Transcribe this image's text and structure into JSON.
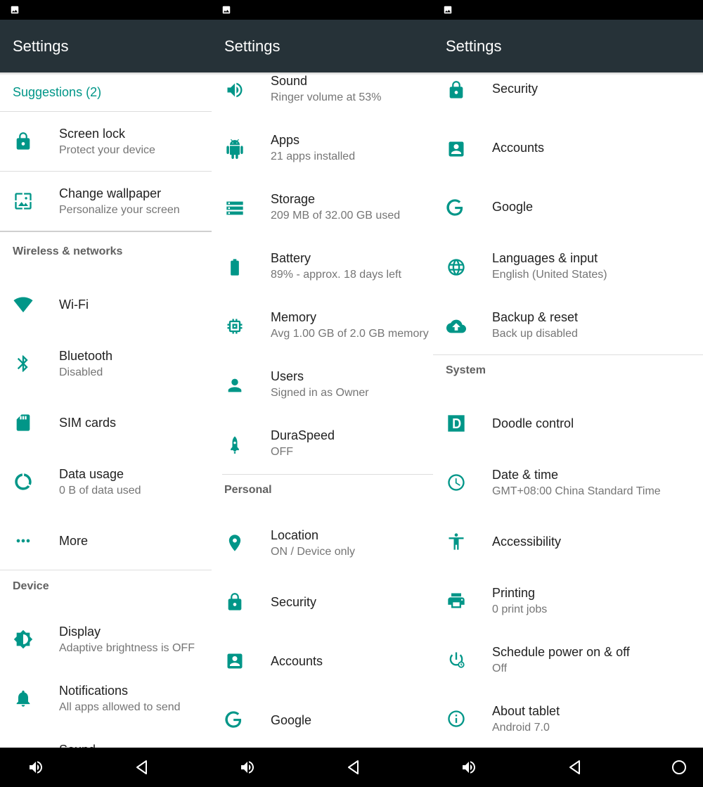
{
  "colors": {
    "accent": "#009688",
    "appbar": "#263238",
    "statusbar": "#000000"
  },
  "panels": [
    {
      "title": "Settings",
      "suggestions": "Suggestions (2)",
      "items": [
        {
          "title": "Screen lock",
          "subtitle": "Protect your device",
          "icon": "lock-icon"
        },
        {
          "title": "Change wallpaper",
          "subtitle": "Personalize your screen",
          "icon": "wallpaper-icon"
        },
        {
          "header": "Wireless & networks"
        },
        {
          "title": "Wi-Fi",
          "icon": "wifi-icon"
        },
        {
          "title": "Bluetooth",
          "subtitle": "Disabled",
          "icon": "bluetooth-icon"
        },
        {
          "title": "SIM cards",
          "icon": "sim-card-icon"
        },
        {
          "title": "Data usage",
          "subtitle": "0 B of data used",
          "icon": "data-usage-icon"
        },
        {
          "title": "More",
          "icon": "more-icon"
        },
        {
          "header": "Device"
        },
        {
          "title": "Display",
          "subtitle": "Adaptive brightness is OFF",
          "icon": "brightness-icon"
        },
        {
          "title": "Notifications",
          "subtitle": "All apps allowed to send",
          "icon": "bell-icon"
        },
        {
          "title": "Sound",
          "icon": "speaker-icon"
        }
      ]
    },
    {
      "title": "Settings",
      "items": [
        {
          "title": "Sound",
          "subtitle": "Ringer volume at 53%",
          "icon": "speaker-icon"
        },
        {
          "title": "Apps",
          "subtitle": "21 apps installed",
          "icon": "android-icon"
        },
        {
          "title": "Storage",
          "subtitle": "209 MB of 32.00 GB used",
          "icon": "storage-icon"
        },
        {
          "title": "Battery",
          "subtitle": "89% - approx. 18 days left",
          "icon": "battery-icon"
        },
        {
          "title": "Memory",
          "subtitle": "Avg 1.00 GB of 2.0 GB memory",
          "icon": "memory-icon"
        },
        {
          "title": "Users",
          "subtitle": "Signed in as Owner",
          "icon": "person-icon"
        },
        {
          "title": "DuraSpeed",
          "subtitle": "OFF",
          "icon": "rocket-icon"
        },
        {
          "header": "Personal"
        },
        {
          "title": "Location",
          "subtitle": "ON / Device only",
          "icon": "location-icon"
        },
        {
          "title": "Security",
          "icon": "lock-icon"
        },
        {
          "title": "Accounts",
          "icon": "account-box-icon"
        },
        {
          "title": "Google",
          "icon": "google-icon"
        }
      ]
    },
    {
      "title": "Settings",
      "items": [
        {
          "title": "Security",
          "icon": "lock-icon"
        },
        {
          "title": "Accounts",
          "icon": "account-box-icon"
        },
        {
          "title": "Google",
          "icon": "google-icon"
        },
        {
          "title": "Languages & input",
          "subtitle": "English (United States)",
          "icon": "globe-icon"
        },
        {
          "title": "Backup & reset",
          "subtitle": "Back up disabled",
          "icon": "cloud-upload-icon"
        },
        {
          "header": "System"
        },
        {
          "title": "Doodle control",
          "icon": "doodle-icon"
        },
        {
          "title": "Date & time",
          "subtitle": "GMT+08:00 China Standard Time",
          "icon": "clock-icon"
        },
        {
          "title": "Accessibility",
          "icon": "accessibility-icon"
        },
        {
          "title": "Printing",
          "subtitle": "0 print jobs",
          "icon": "printer-icon"
        },
        {
          "title": "Schedule power on & off",
          "subtitle": "Off",
          "icon": "power-schedule-icon"
        },
        {
          "title": "About tablet",
          "subtitle": "Android 7.0",
          "icon": "info-icon"
        }
      ]
    }
  ],
  "navbar": {
    "buttons": [
      {
        "icon": "volume-icon"
      },
      {
        "icon": "back-icon"
      },
      {
        "icon": "volume-icon"
      },
      {
        "icon": "back-icon"
      },
      {
        "icon": "volume-icon"
      },
      {
        "icon": "back-icon"
      },
      {
        "icon": "home-icon"
      }
    ]
  }
}
